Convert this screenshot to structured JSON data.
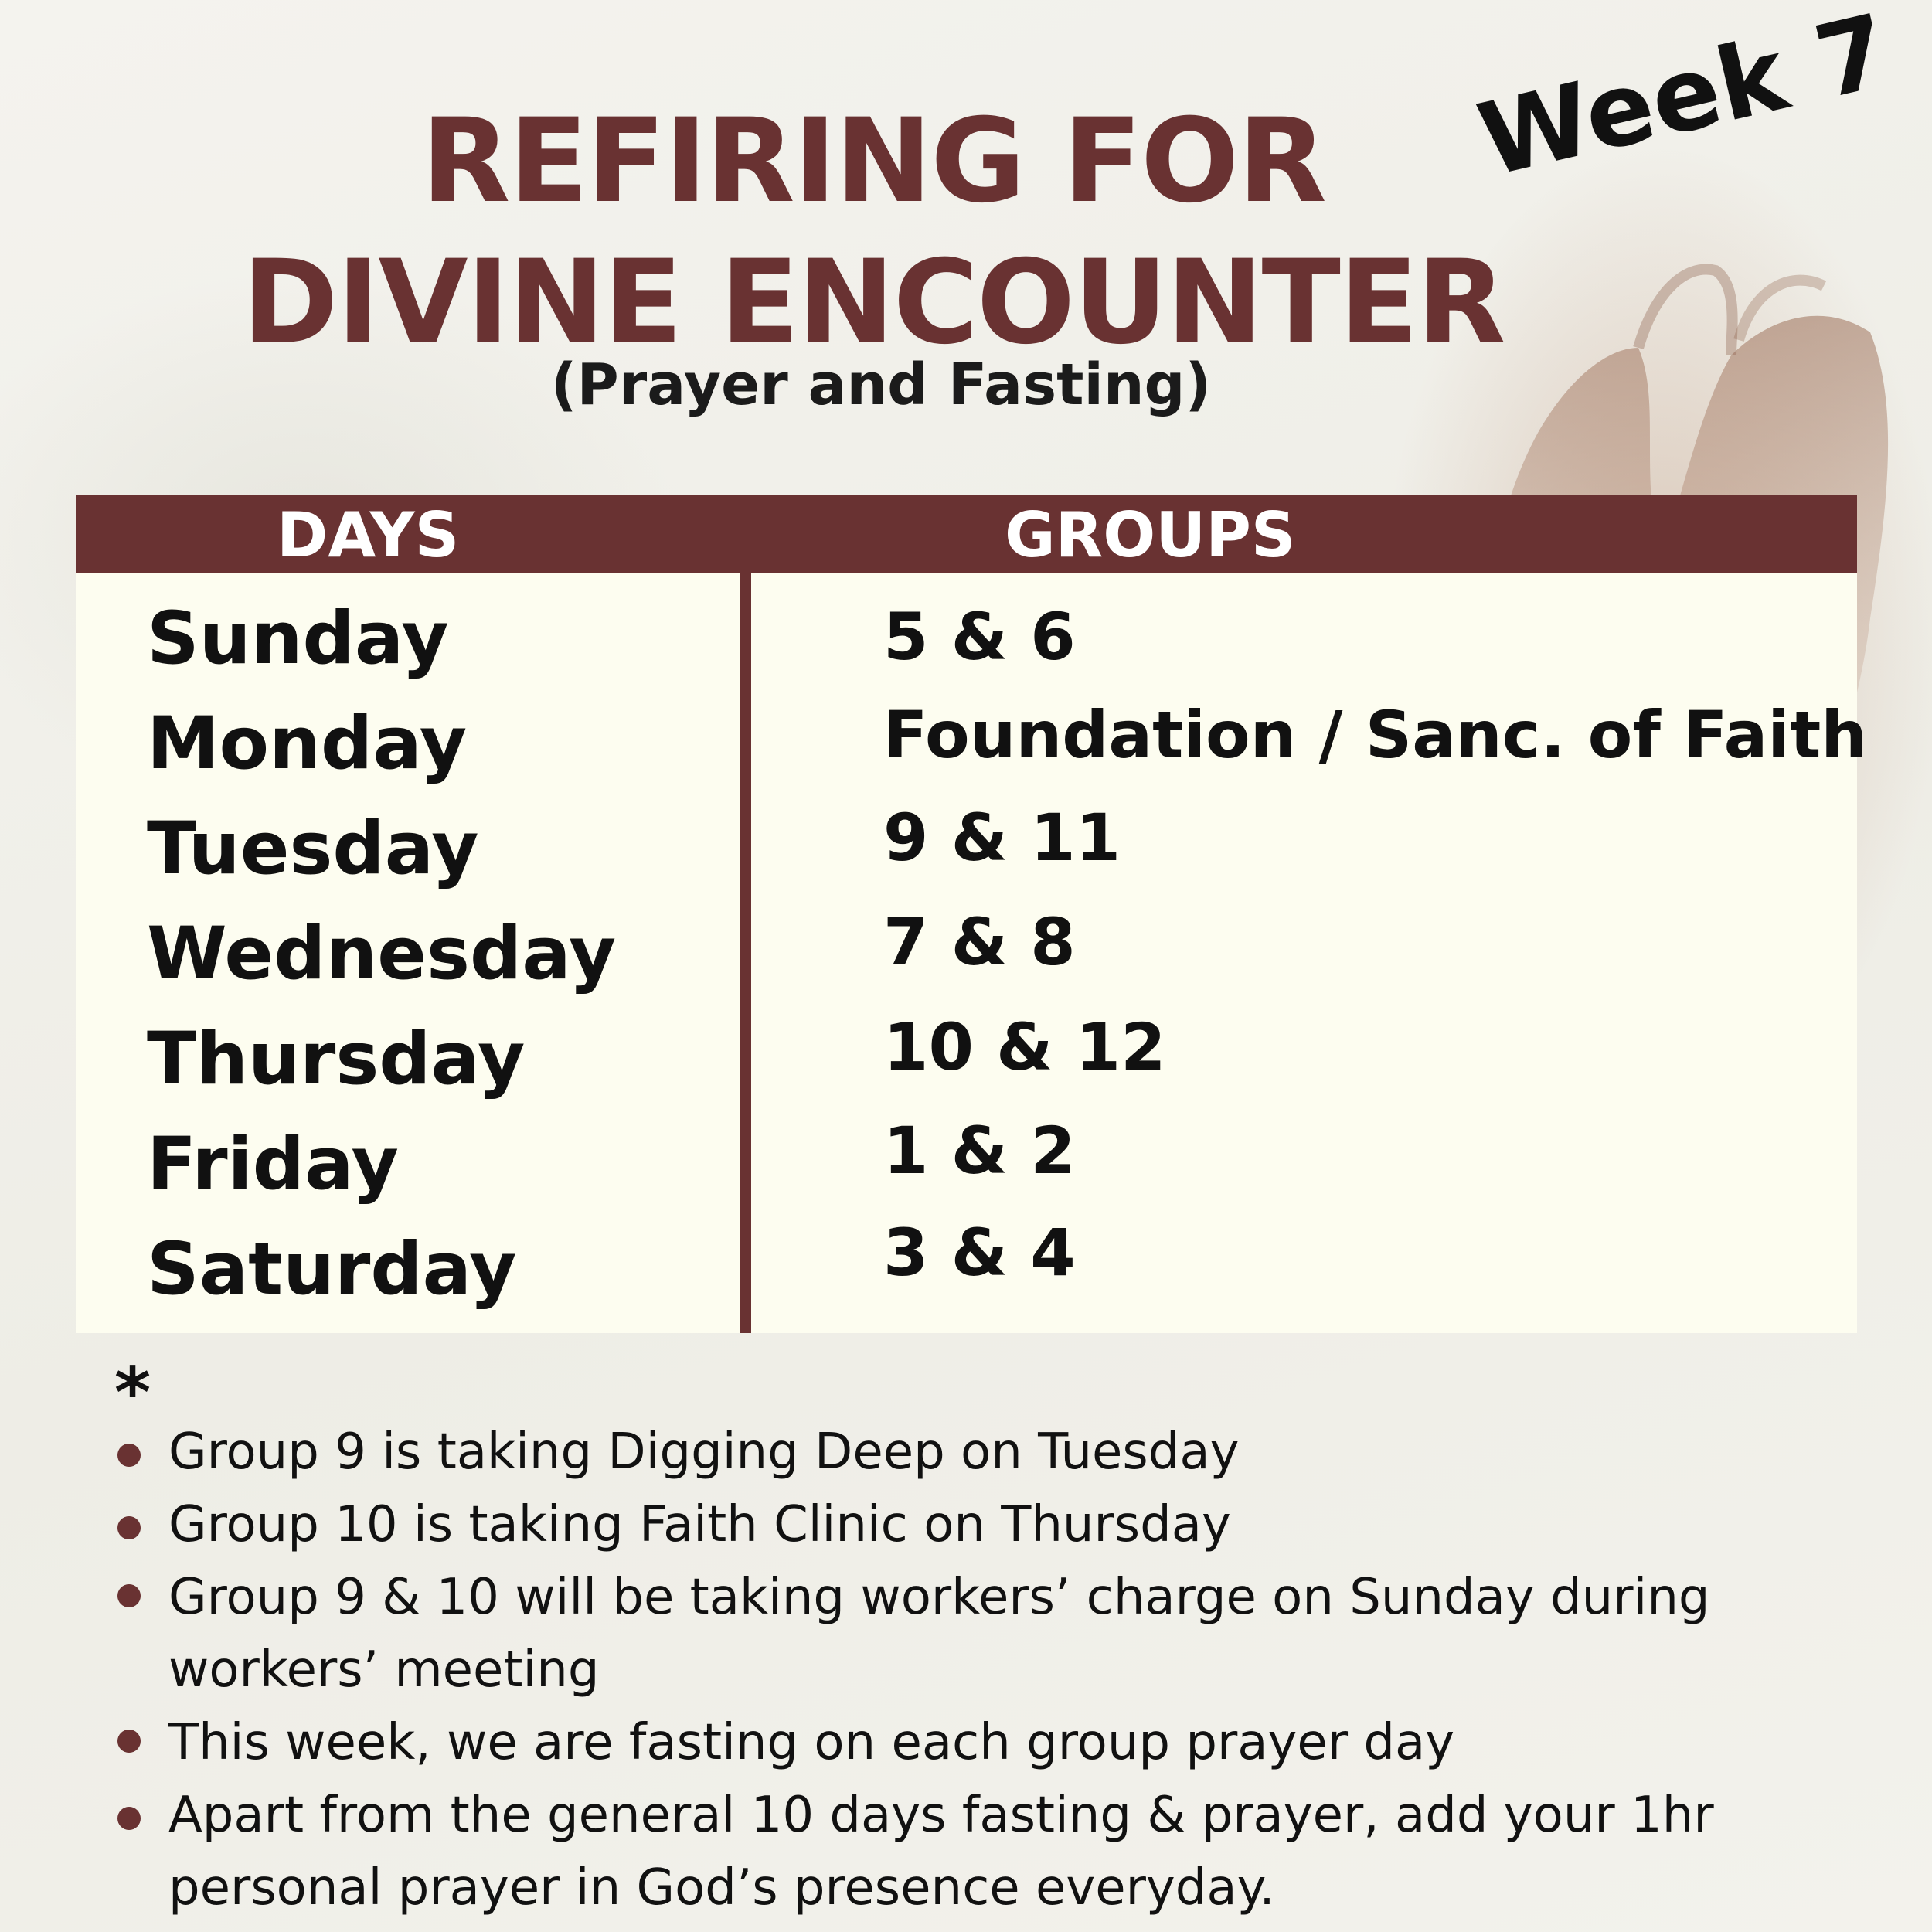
{
  "header": {
    "title_line1": "REFIRING FOR",
    "title_line2": "DIVINE ENCOUNTER",
    "subtitle": "(Prayer and Fasting)",
    "week_label": "Week 7"
  },
  "table": {
    "col_days": "DAYS",
    "col_groups": "GROUPS",
    "rows": [
      {
        "day": "Sunday",
        "groups": "5 & 6"
      },
      {
        "day": "Monday",
        "groups": "Foundation / Sanc. of Faith"
      },
      {
        "day": "Tuesday",
        "groups": "9 & 11"
      },
      {
        "day": "Wednesday",
        "groups": "7 & 8"
      },
      {
        "day": "Thursday",
        "groups": "10 & 12"
      },
      {
        "day": "Friday",
        "groups": "1 & 2"
      },
      {
        "day": "Saturday",
        "groups": "3 & 4"
      }
    ]
  },
  "notes": {
    "marker": "*",
    "items": [
      "Group 9 is taking Digging Deep on Tuesday",
      "Group 10 is taking Faith Clinic on Thursday",
      "Group 9 & 10 will be taking workers’ charge on Sunday during workers’ meeting",
      "This week, we are fasting on each group prayer day",
      "Apart from the general 10 days fasting & prayer, add your 1hr personal prayer in God’s presence everyday."
    ]
  },
  "colors": {
    "brand": "#693232",
    "table_bg": "#fdfdf0",
    "page_bg": "#f1f0ea",
    "text": "#111111"
  }
}
